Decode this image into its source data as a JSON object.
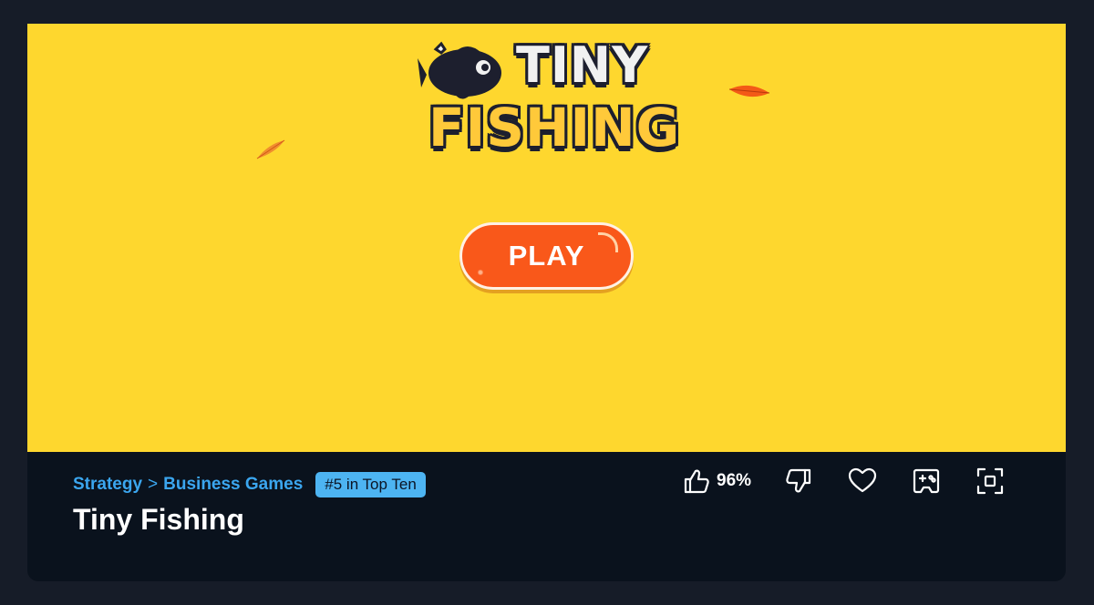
{
  "game": {
    "logo_line1": "TINY",
    "logo_line2": "FISHING",
    "play_label": "PLAY"
  },
  "info": {
    "breadcrumb": {
      "category": "Strategy",
      "separator": ">",
      "subcategory": "Business Games"
    },
    "rank_badge": "#5 in Top Ten",
    "title": "Tiny Fishing",
    "like_percent": "96%"
  },
  "icons": {
    "like": "thumbs-up-icon",
    "dislike": "thumbs-down-icon",
    "favorite": "heart-icon",
    "gamepad": "gamepad-icon",
    "fullscreen": "fullscreen-icon"
  },
  "colors": {
    "game_bg": "#fed72e",
    "play_button": "#f9581a",
    "info_bg": "#0a121d",
    "link": "#3ba6ef",
    "badge": "#4db4f2"
  }
}
